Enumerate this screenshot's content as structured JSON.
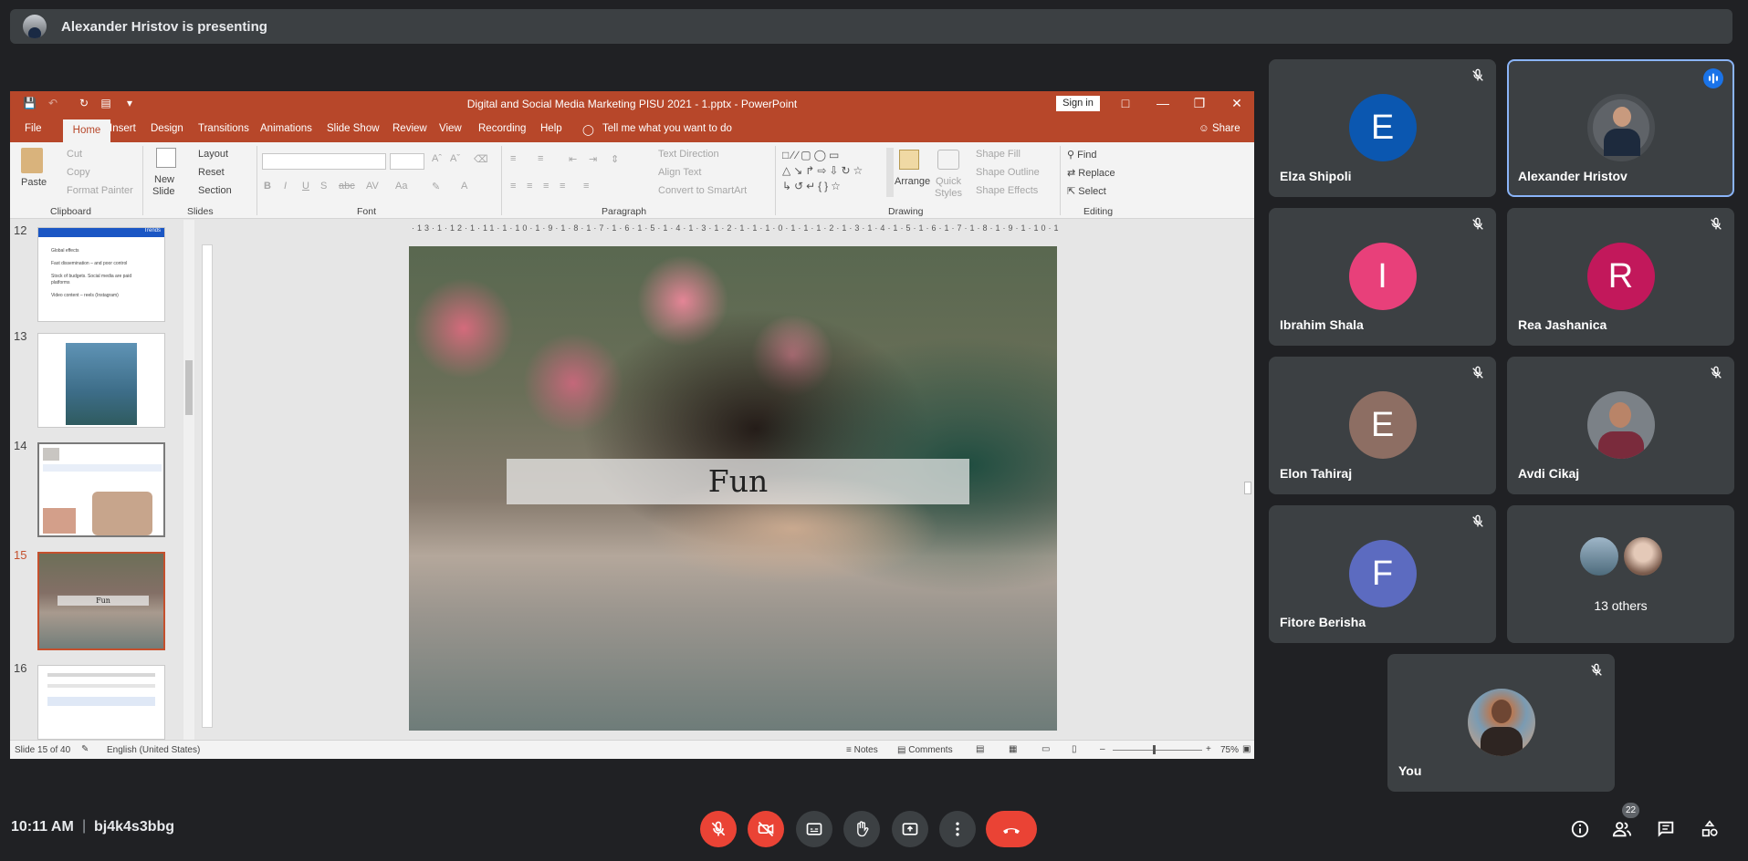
{
  "presenter": {
    "text": "Alexander Hristov is presenting"
  },
  "ppt": {
    "window_title": "Digital and Social Media Marketing PISU 2021 - 1.pptx  -  PowerPoint",
    "signin": "Sign in",
    "tabs": [
      "File",
      "Home",
      "Insert",
      "Design",
      "Transitions",
      "Animations",
      "Slide Show",
      "Review",
      "View",
      "Recording",
      "Help"
    ],
    "tell_me": "Tell me what you want to do",
    "share": "Share",
    "ribbon": {
      "paste": "Paste",
      "cut": "Cut",
      "copy": "Copy",
      "format_painter": "Format Painter",
      "clipboard": "Clipboard",
      "new_slide": "New",
      "new_slide2": "Slide",
      "layout": "Layout",
      "reset": "Reset",
      "section": "Section",
      "slides": "Slides",
      "font": "Font",
      "text_direction": "Text Direction",
      "align_text": "Align Text",
      "convert_smartart": "Convert to SmartArt",
      "paragraph": "Paragraph",
      "arrange": "Arrange",
      "quick": "Quick",
      "styles": "Styles",
      "shape_fill": "Shape Fill",
      "shape_outline": "Shape Outline",
      "shape_effects": "Shape Effects",
      "drawing": "Drawing",
      "find": "Find",
      "replace": "Replace",
      "select": "Select",
      "editing": "Editing"
    },
    "thumbnails": [
      {
        "num": "12",
        "lines": [
          "Global effects",
          "Fast dissemination – and poor control",
          "Stock of budgets. Social media are paid platforms",
          "Video content – reels (Instagram)"
        ],
        "header": "Trends"
      },
      {
        "num": "13"
      },
      {
        "num": "14"
      },
      {
        "num": "15",
        "caption": "Fun",
        "selected": true
      },
      {
        "num": "16"
      }
    ],
    "ruler_h": "·13·1·12·1·11·1·10·1·9·1·8·1·7·1·6·1·5·1·4·1·3·1·2·1·1·1·0·1·1·1·2·1·3·1·4·1·5·1·6·1·7·1·8·1·9·1·10·1·11·1·12·1·13·",
    "slide_title": "Fun",
    "status": {
      "slide_of": "Slide 15 of 40",
      "language": "English (United States)",
      "notes": "Notes",
      "comments": "Comments",
      "zoom": "75%"
    }
  },
  "participants": [
    {
      "name": "Elza Shipoli",
      "initial": "E",
      "color": "#0b57b0",
      "muted": true
    },
    {
      "name": "Alexander Hristov",
      "photo": true,
      "speaking": true
    },
    {
      "name": "Ibrahim Shala",
      "initial": "I",
      "color": "#e8407a",
      "muted": true
    },
    {
      "name": "Rea Jashanica",
      "initial": "R",
      "color": "#c2185b",
      "muted": true
    },
    {
      "name": "Elon Tahiraj",
      "initial": "E",
      "color": "#8d6e63",
      "muted": true
    },
    {
      "name": "Avdi Cikaj",
      "photo": true,
      "muted": true
    },
    {
      "name": "Fitore Berisha",
      "initial": "F",
      "color": "#5c6bc0",
      "muted": true
    },
    {
      "name": "13 others",
      "group": true
    },
    {
      "name": "You",
      "photo": true,
      "muted": true
    }
  ],
  "bottom": {
    "time": "10:11 AM",
    "separator": "|",
    "code": "bj4k4s3bbg",
    "people_count": "22"
  },
  "colors": {
    "ppt_accent": "#b7472a",
    "meet_bg": "#202124",
    "tile_bg": "#3c4043",
    "danger": "#ea4335",
    "active_border": "#8ab4f8"
  }
}
